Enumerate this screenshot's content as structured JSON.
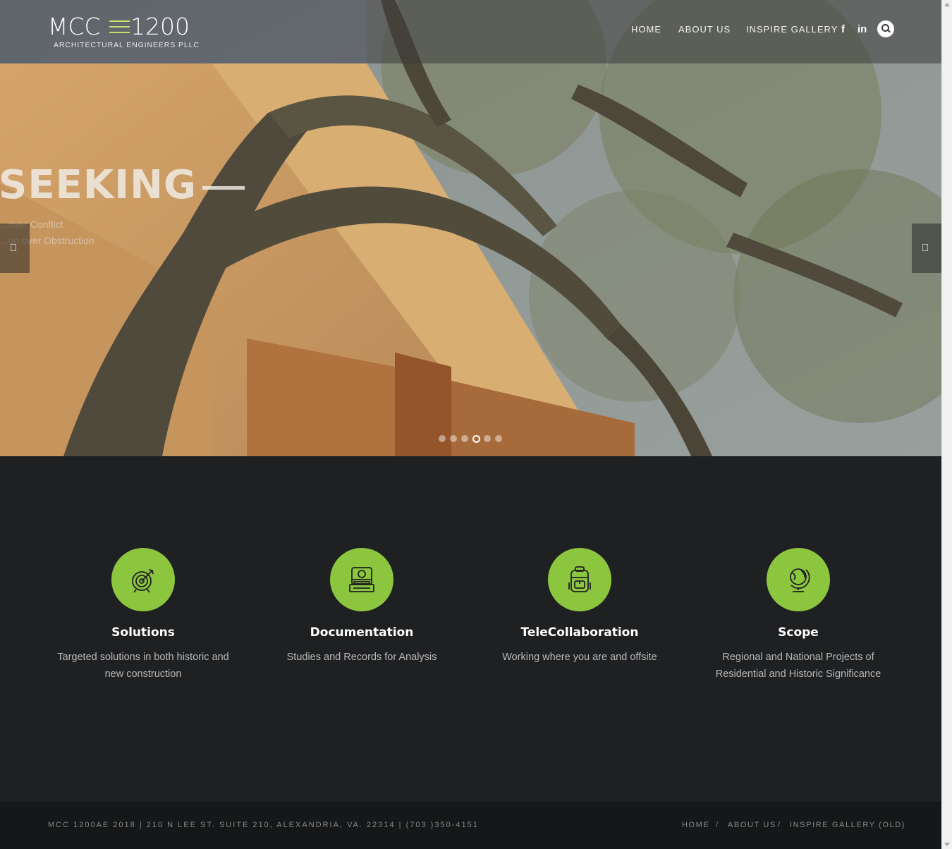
{
  "brand": {
    "logo_left": "MCC",
    "logo_right": "1200",
    "logo_sub": "ARCHITECTURAL ENGINEERS PLLC",
    "accent": "#8cc63f"
  },
  "nav": {
    "items": [
      "HOME",
      "ABOUT US",
      "INSPIRE GALLERY"
    ],
    "facebook": "f",
    "linkedin": "in",
    "icons": [
      "facebook-icon",
      "linkedin-icon",
      "search-icon"
    ]
  },
  "slider": {
    "heading": "SEEKING",
    "line1": "...over Conflict",
    "line2": "...on over Obstruction",
    "dot_count": 6,
    "active_dot": 4,
    "icons": [
      "chevron-left-icon",
      "chevron-right-icon"
    ]
  },
  "features": [
    {
      "icon": "target-arrow-icon",
      "title": "Solutions",
      "desc": "Targeted solutions in both historic and new construction"
    },
    {
      "icon": "instant-camera-icon",
      "title": "Documentation",
      "desc": "Studies and Records for Analysis"
    },
    {
      "icon": "backpack-icon",
      "title": "TeleCollaboration",
      "desc": "Working where you are and offsite"
    },
    {
      "icon": "globe-icon",
      "title": "Scope",
      "desc": "Regional and National Projects of Residential and Historic Significance"
    }
  ],
  "footer": {
    "copyright": "MCC 1200AE 2018 | 210 N LEE ST. SUITE 210, ALEXANDRIA, VA. 22314 | (703 )350-4151",
    "links": [
      "HOME",
      "ABOUT US",
      "INSPIRE GALLERY (OLD)"
    ],
    "separator": "/"
  }
}
